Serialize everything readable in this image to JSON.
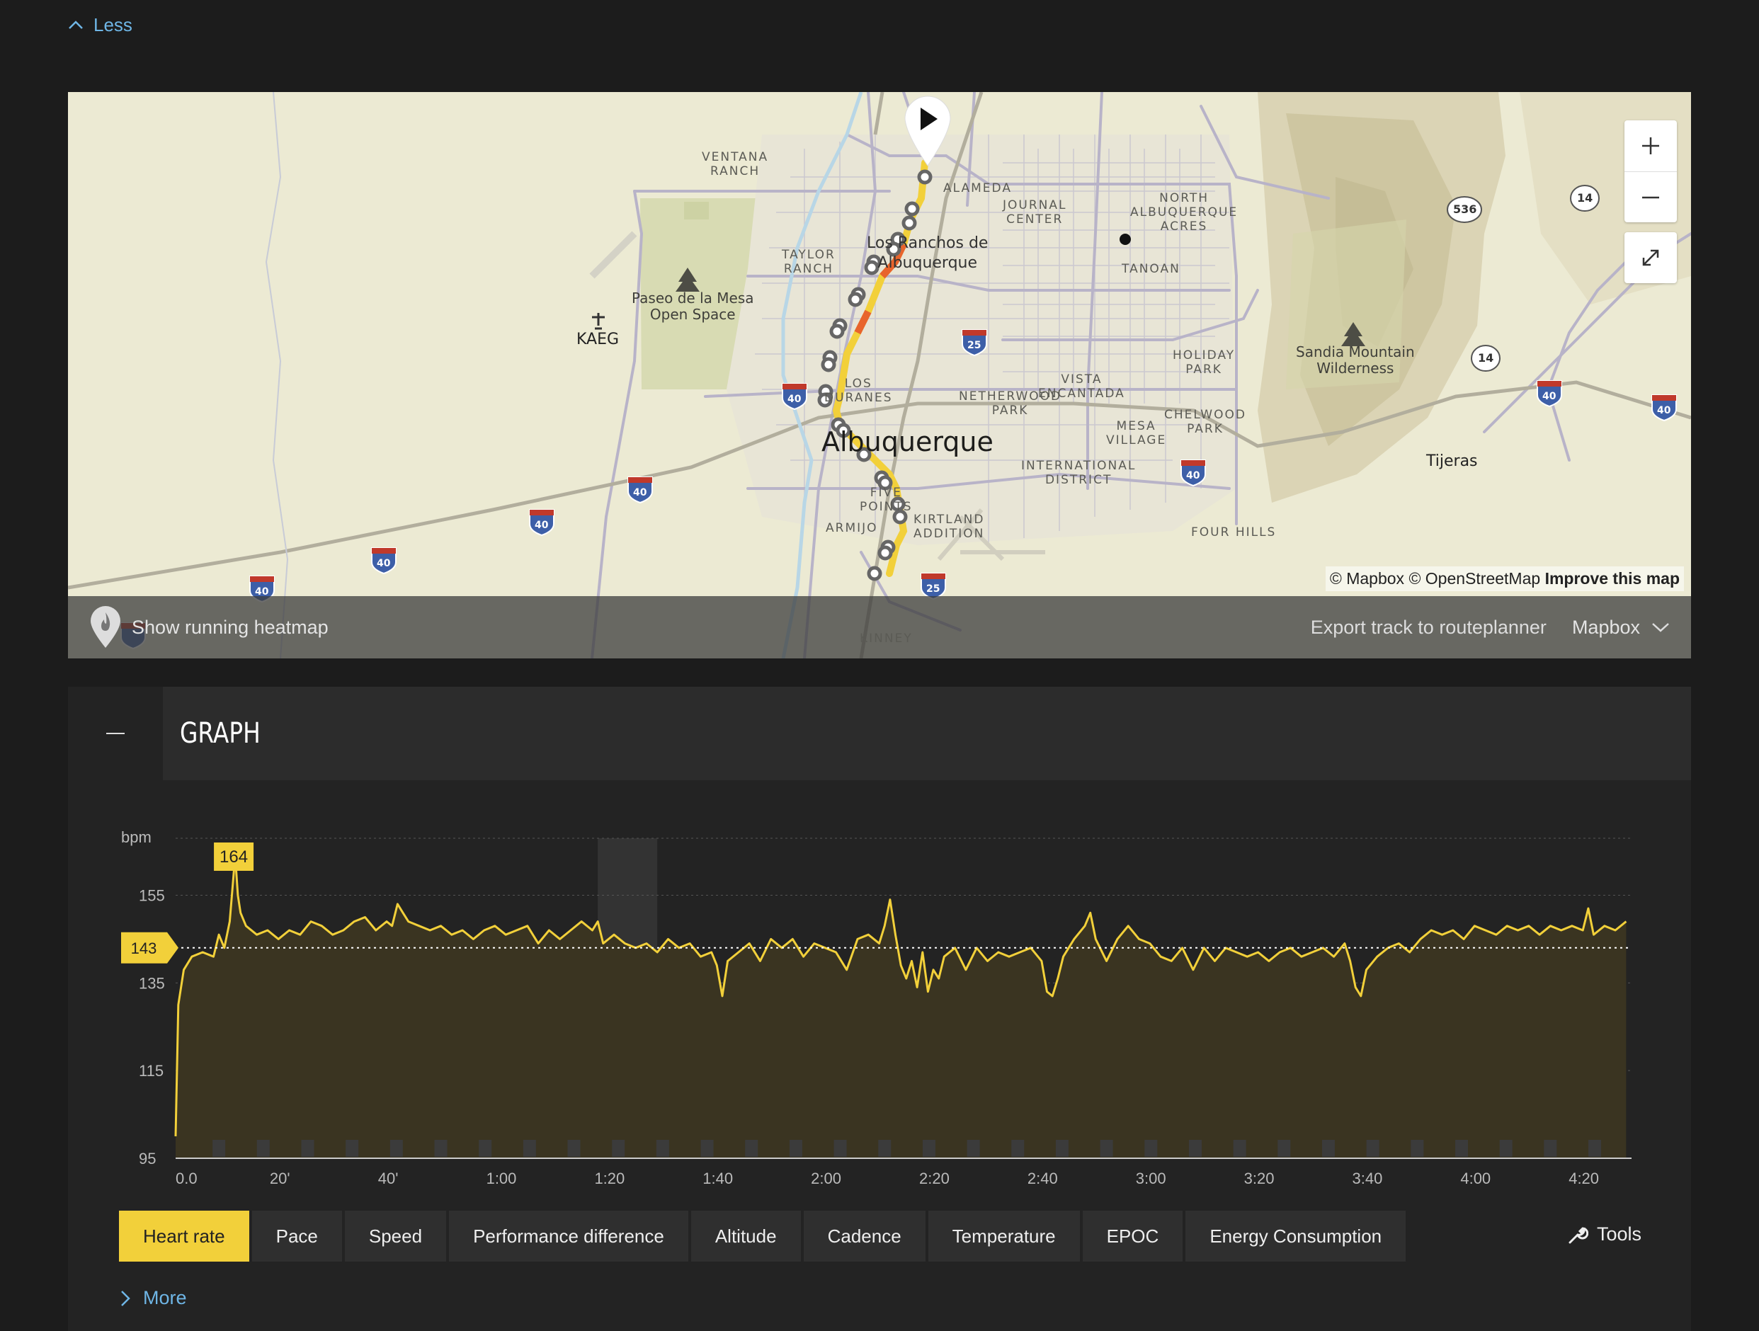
{
  "top": {
    "less_label": "Less"
  },
  "map": {
    "attribution": {
      "mapbox": "© Mapbox",
      "osm": "© OpenStreetMap",
      "improve": "Improve this map"
    },
    "heatmap_label": "Show running heatmap",
    "export_label": "Export track to routeplanner",
    "provider_label": "Mapbox",
    "labels": {
      "ventana_ranch": "VENTANA\nRANCH",
      "alameda": "ALAMEDA",
      "north_abq_acres": "NORTH\nALBUQUERQUE\nACRES",
      "journal_center": "JOURNAL\nCENTER",
      "tanoan": "TANOAN",
      "taylor_ranch": "TAYLOR\nRANCH",
      "los_ranchos": "Los Ranchos de\nAlbuquerque",
      "paseo": "Paseo de la Mesa\nOpen Space",
      "kaeg": "KAEG",
      "holiday_park": "HOLIDAY\nPARK",
      "sandia": "Sandia Mountain\nWilderness",
      "los_duranes": "LOS\nDURANES",
      "netherwood": "NETHERWOOD\nPARK",
      "vista_encantada": "VISTA\nENCANTADA",
      "chelwood": "CHELWOOD\nPARK",
      "mesa_village": "MESA\nVILLAGE",
      "albuquerque": "Albuquerque",
      "international": "INTERNATIONAL\nDISTRICT",
      "tijeras": "Tijeras",
      "five_points": "FIVE\nPOINTS",
      "kirtland": "KIRTLAND\nADDITION",
      "armijo": "ARMIJO",
      "four_hills": "FOUR HILLS",
      "kinney": "KINNEY"
    },
    "shields": {
      "i40": "40",
      "i25": "25",
      "r536": "536",
      "r14": "14"
    },
    "colors": {
      "track": "#f2d03a",
      "track_fast": "#e8642c",
      "land": "#ecead3",
      "roads": "#b8b3c8"
    }
  },
  "graph": {
    "title": "GRAPH",
    "tabs": [
      "Heart rate",
      "Pace",
      "Speed",
      "Performance difference",
      "Altitude",
      "Cadence",
      "Temperature",
      "EPOC",
      "Energy Consumption"
    ],
    "active_tab": 0,
    "tools_label": "Tools",
    "more_label": "More"
  },
  "chart_data": {
    "type": "area",
    "title": "",
    "ylabel": "bpm",
    "xlabel": "",
    "ylim": [
      95,
      168
    ],
    "y_ticks": [
      95,
      115,
      135,
      155
    ],
    "x_ticks": [
      "0.0",
      "20'",
      "40'",
      "1:00",
      "1:20",
      "1:40",
      "2:00",
      "2:20",
      "2:40",
      "3:00",
      "3:20",
      "3:40",
      "4:00",
      "4:20"
    ],
    "x_minutes": [
      0,
      20,
      40,
      60,
      80,
      100,
      120,
      140,
      160,
      180,
      200,
      220,
      240,
      260
    ],
    "xlim": [
      0,
      269
    ],
    "average": 143,
    "max": 164,
    "max_at_minute": 11,
    "highlight_range": [
      78,
      89
    ],
    "series": [
      {
        "values": [
          [
            0,
            100
          ],
          [
            0.5,
            130
          ],
          [
            1.5,
            138
          ],
          [
            3,
            141
          ],
          [
            5,
            142
          ],
          [
            7,
            141
          ],
          [
            8,
            146
          ],
          [
            9,
            143
          ],
          [
            10,
            149
          ],
          [
            11,
            164
          ],
          [
            11.5,
            155
          ],
          [
            12,
            151
          ],
          [
            13,
            148
          ],
          [
            15,
            146
          ],
          [
            17,
            147
          ],
          [
            19,
            145
          ],
          [
            21,
            147
          ],
          [
            23,
            146
          ],
          [
            25,
            149
          ],
          [
            27,
            148
          ],
          [
            29,
            146
          ],
          [
            31,
            147
          ],
          [
            33,
            149
          ],
          [
            35,
            150
          ],
          [
            37,
            147
          ],
          [
            39,
            149
          ],
          [
            40,
            148
          ],
          [
            41,
            153
          ],
          [
            42,
            151
          ],
          [
            43,
            149
          ],
          [
            45,
            148
          ],
          [
            47,
            147
          ],
          [
            49,
            148
          ],
          [
            51,
            146
          ],
          [
            53,
            147
          ],
          [
            55,
            145
          ],
          [
            57,
            147
          ],
          [
            59,
            148
          ],
          [
            61,
            146
          ],
          [
            63,
            147
          ],
          [
            65,
            148
          ],
          [
            67,
            144
          ],
          [
            69,
            147
          ],
          [
            71,
            145
          ],
          [
            73,
            147
          ],
          [
            75,
            149
          ],
          [
            77,
            147
          ],
          [
            78,
            149
          ],
          [
            79,
            144
          ],
          [
            81,
            146
          ],
          [
            83,
            144
          ],
          [
            85,
            143
          ],
          [
            87,
            144
          ],
          [
            89,
            142
          ],
          [
            91,
            145
          ],
          [
            93,
            143
          ],
          [
            95,
            144
          ],
          [
            97,
            141
          ],
          [
            99,
            142
          ],
          [
            100,
            139
          ],
          [
            101,
            132
          ],
          [
            102,
            140
          ],
          [
            104,
            142
          ],
          [
            106,
            144
          ],
          [
            108,
            140
          ],
          [
            110,
            145
          ],
          [
            112,
            143
          ],
          [
            114,
            145
          ],
          [
            116,
            141
          ],
          [
            118,
            144
          ],
          [
            120,
            143
          ],
          [
            122,
            142
          ],
          [
            124,
            138
          ],
          [
            126,
            145
          ],
          [
            128,
            146
          ],
          [
            130,
            144
          ],
          [
            131,
            148
          ],
          [
            132,
            154
          ],
          [
            133,
            146
          ],
          [
            134,
            139
          ],
          [
            135,
            136
          ],
          [
            136,
            140
          ],
          [
            137,
            134
          ],
          [
            138,
            142
          ],
          [
            139,
            133
          ],
          [
            140,
            138
          ],
          [
            141,
            136
          ],
          [
            142,
            141
          ],
          [
            144,
            143
          ],
          [
            146,
            138
          ],
          [
            148,
            143
          ],
          [
            150,
            140
          ],
          [
            152,
            142
          ],
          [
            154,
            141
          ],
          [
            156,
            142
          ],
          [
            158,
            143
          ],
          [
            160,
            140
          ],
          [
            161,
            133
          ],
          [
            162,
            132
          ],
          [
            163,
            136
          ],
          [
            164,
            141
          ],
          [
            166,
            145
          ],
          [
            168,
            148
          ],
          [
            169,
            151
          ],
          [
            170,
            145
          ],
          [
            172,
            140
          ],
          [
            174,
            145
          ],
          [
            176,
            148
          ],
          [
            178,
            145
          ],
          [
            180,
            144
          ],
          [
            182,
            141
          ],
          [
            184,
            140
          ],
          [
            186,
            143
          ],
          [
            188,
            138
          ],
          [
            190,
            143
          ],
          [
            192,
            140
          ],
          [
            194,
            143
          ],
          [
            196,
            142
          ],
          [
            198,
            141
          ],
          [
            200,
            142
          ],
          [
            202,
            140
          ],
          [
            204,
            142
          ],
          [
            206,
            143
          ],
          [
            208,
            141
          ],
          [
            210,
            142
          ],
          [
            212,
            143
          ],
          [
            214,
            141
          ],
          [
            216,
            144
          ],
          [
            217,
            140
          ],
          [
            218,
            134
          ],
          [
            219,
            132
          ],
          [
            220,
            138
          ],
          [
            222,
            141
          ],
          [
            224,
            143
          ],
          [
            226,
            144
          ],
          [
            228,
            142
          ],
          [
            230,
            145
          ],
          [
            232,
            147
          ],
          [
            234,
            146
          ],
          [
            236,
            147
          ],
          [
            238,
            145
          ],
          [
            240,
            148
          ],
          [
            242,
            147
          ],
          [
            244,
            146
          ],
          [
            246,
            148
          ],
          [
            248,
            147
          ],
          [
            250,
            148
          ],
          [
            252,
            146
          ],
          [
            254,
            148
          ],
          [
            256,
            147
          ],
          [
            258,
            148
          ],
          [
            260,
            147
          ],
          [
            261,
            152
          ],
          [
            262,
            146
          ],
          [
            264,
            148
          ],
          [
            266,
            147
          ],
          [
            268,
            149
          ]
        ]
      }
    ]
  }
}
